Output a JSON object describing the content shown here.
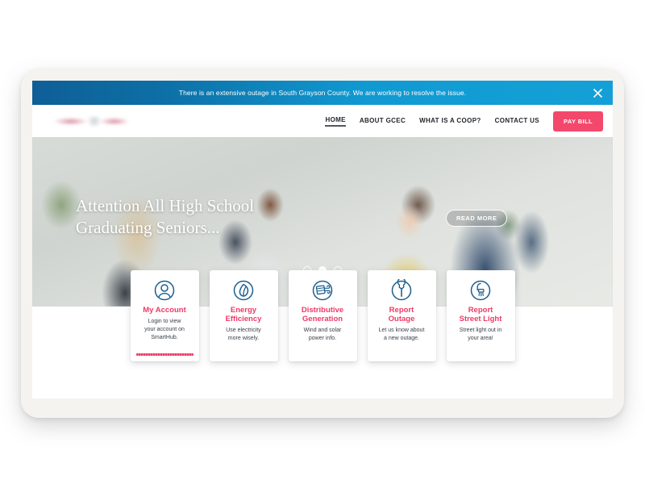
{
  "alert": {
    "message": "There is an extensive outage in South Grayson County. We are working to resolve the issue.",
    "close_icon": "close-icon"
  },
  "header": {
    "logo_alt": "GCEC logo",
    "nav": [
      {
        "label": "HOME",
        "active": true
      },
      {
        "label": "ABOUT GCEC",
        "active": false
      },
      {
        "label": "WHAT IS A COOP?",
        "active": false
      },
      {
        "label": "CONTACT US",
        "active": false
      }
    ],
    "pay_bill_label": "PAY BILL"
  },
  "hero": {
    "title": "Attention All High School\nGraduating Seniors...",
    "read_more_label": "READ MORE",
    "slides": 3,
    "active_slide": 2
  },
  "cards": [
    {
      "icon": "account-person-icon",
      "title": "My Account",
      "desc": "Login to view\nyour account on\nSmartHub.",
      "accent": true
    },
    {
      "icon": "leaf-icon",
      "title": "Energy\nEfficiency",
      "desc": "Use electricity\nmore wisely.",
      "accent": false
    },
    {
      "icon": "solar-wind-icon",
      "title": "Distributive\nGeneration",
      "desc": "Wind and solar\npower info.",
      "accent": false
    },
    {
      "icon": "wrench-icon",
      "title": "Report\nOutage",
      "desc": "Let us know about\na new outage.",
      "accent": false
    },
    {
      "icon": "street-light-icon",
      "title": "Report\nStreet Light",
      "desc": "Street light out in\nyour area!",
      "accent": false
    }
  ],
  "colors": {
    "alert_blue_dark": "#0e5f96",
    "alert_blue_light": "#14a0d6",
    "accent_pink": "#ee3a66",
    "pay_bill_pink": "#f4476c",
    "icon_blue": "#1c5f8e",
    "body_text": "#3a4048"
  }
}
